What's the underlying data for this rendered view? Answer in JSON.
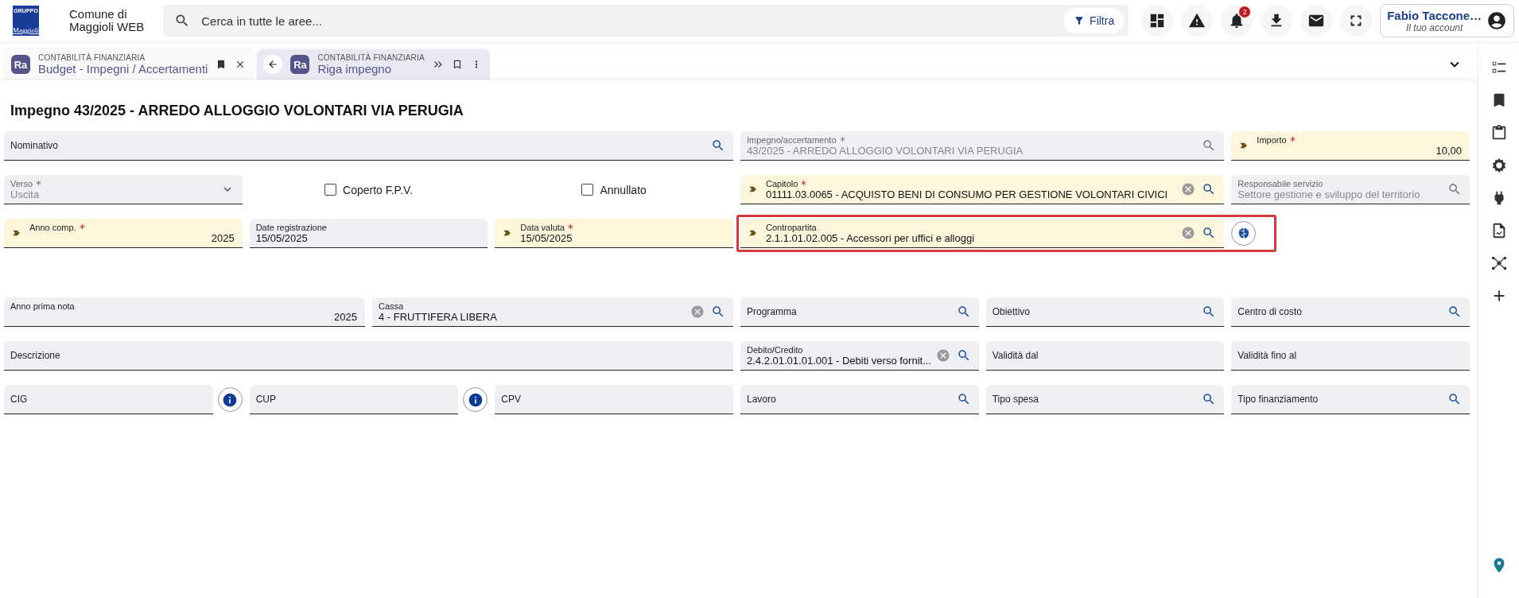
{
  "brand": {
    "logo_top": "GRUPPO",
    "logo_word": "Maggioli",
    "app_name_1": "Comune di",
    "app_name_2": "Maggioli WEB"
  },
  "search": {
    "placeholder": "Cerca in tutte le aree...",
    "filter_label": "Filtra"
  },
  "notifications": {
    "badge": "2"
  },
  "user": {
    "name": "Fabio Taccone…",
    "subtitle": "Il tuo account"
  },
  "tabs": [
    {
      "badge": "Ra",
      "category": "CONTABILITÀ FINANZIARIA",
      "title": "Budget - Impegni / Accertamenti",
      "selected": false
    },
    {
      "badge": "Ra",
      "category": "CONTABILITÀ FINANZIARIA",
      "title": "Riga impegno",
      "selected": true
    }
  ],
  "page_title": "Impegno 43/2025 - ARREDO ALLOGGIO VOLONTARI VIA PERUGIA",
  "form_rows": [
    [
      {
        "kind": "lookup",
        "label": "Nominativo"
      },
      {
        "kind": "lookup",
        "label": "Impegno/accertamento",
        "value": "43/2025 - ARREDO ALLOGGIO VOLONTARI VIA PERUGIA",
        "required": true,
        "readonly": true
      },
      {
        "kind": "number",
        "label": "Importo",
        "value": "10,00",
        "required": true,
        "linked": true
      }
    ],
    [
      {
        "kind": "select",
        "label": "Verso",
        "value": "Uscita",
        "required": true,
        "readonly": true
      },
      {
        "kind": "checkbox",
        "label": "Coperto F.P.V.",
        "checked": false
      },
      {
        "kind": "checkbox",
        "label": "Annullato",
        "checked": false
      },
      {
        "kind": "lookup",
        "label": "Capitolo",
        "value": "01111.03.0065 - ACQUISTO BENI DI CONSUMO PER GESTIONE VOLONTARI CIVICI",
        "required": true,
        "linked": true,
        "clearable": true
      },
      {
        "kind": "lookup",
        "label": "Responsabile servizio",
        "value": "Settore gestione e sviluppo del territorio",
        "readonly": true
      }
    ],
    [
      {
        "kind": "number",
        "label": "Anno comp.",
        "value": "2025",
        "required": true,
        "linked": true
      },
      {
        "kind": "text",
        "label": "Date registrazione",
        "value": "15/05/2025"
      },
      {
        "kind": "text",
        "label": "Data valuta",
        "value": "15/05/2025",
        "required": true,
        "linked": true
      },
      {
        "kind": "lookup",
        "label": "Contropartita",
        "value": "2.1.1.01.02.005 - Accessori per uffici e alloggi",
        "linked": true,
        "clearable": true,
        "assist_button": true,
        "highlighted": true
      }
    ],
    [
      {
        "kind": "number",
        "label": "Anno prima nota",
        "value": "2025"
      },
      {
        "kind": "lookup",
        "label": "Cassa",
        "value": "4 - FRUTTIFERA LIBERA",
        "clearable": true
      },
      {
        "kind": "lookup",
        "label": "Programma"
      },
      {
        "kind": "lookup",
        "label": "Obiettivo"
      },
      {
        "kind": "lookup",
        "label": "Centro di costo"
      }
    ],
    [
      {
        "kind": "text",
        "label": "Descrizione"
      },
      {
        "kind": "lookup",
        "label": "Debito/Credito",
        "value": "2.4.2.01.01.01.001 - Debiti verso fornit...",
        "clearable": true
      },
      {
        "kind": "text",
        "label": "Validità dal"
      },
      {
        "kind": "text",
        "label": "Validità fino al"
      }
    ],
    [
      {
        "kind": "text",
        "label": "CIG",
        "info_button": true
      },
      {
        "kind": "text",
        "label": "CUP",
        "info_button": true
      },
      {
        "kind": "text",
        "label": "CPV"
      },
      {
        "kind": "lookup",
        "label": "Lavoro"
      },
      {
        "kind": "lookup",
        "label": "Tipo spesa"
      },
      {
        "kind": "lookup",
        "label": "Tipo finanziamento"
      }
    ]
  ]
}
